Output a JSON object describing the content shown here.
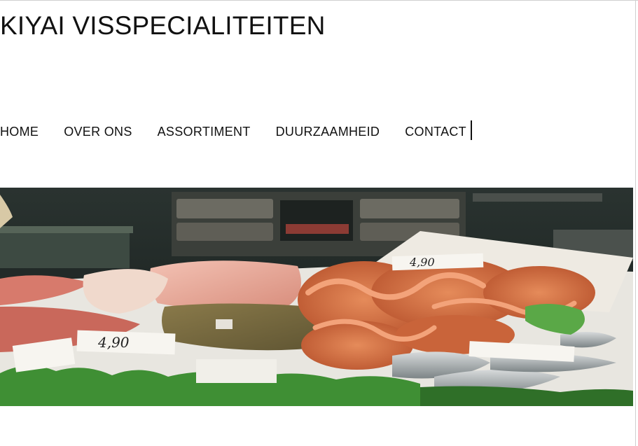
{
  "header": {
    "site_title": "KIYAI VISSPECIALITEITEN"
  },
  "nav": {
    "items": [
      {
        "label": "HOME"
      },
      {
        "label": "OVER ONS"
      },
      {
        "label": "ASSORTIMENT"
      },
      {
        "label": "DUURZAAMHEID"
      },
      {
        "label": "CONTACT"
      }
    ]
  },
  "hero": {
    "price_tags": [
      "4,90",
      "4,90"
    ],
    "colors": {
      "background": "#1e2624",
      "octopus": "#d9774a",
      "lettuce": "#3f8f34",
      "ice": "#e8e6e0"
    }
  }
}
